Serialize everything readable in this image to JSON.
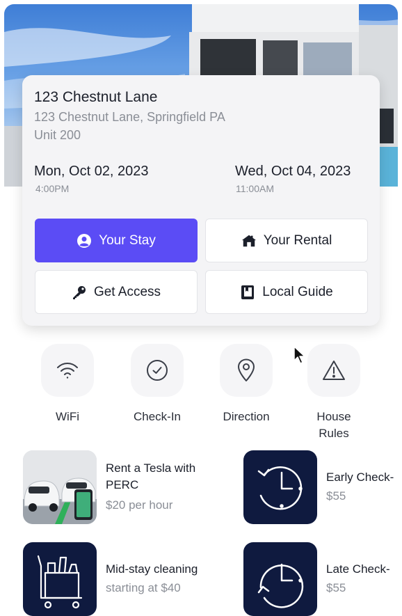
{
  "property": {
    "name": "123 Chestnut Lane",
    "address": "123 Chestnut Lane, Springfield PA",
    "unit": "Unit 200"
  },
  "stay": {
    "check_in_date": "Mon, Oct 02, 2023",
    "check_in_time": "4:00PM",
    "check_out_date": "Wed, Oct 04, 2023",
    "check_out_time": "11:00AM"
  },
  "actions": {
    "your_stay": "Your Stay",
    "your_rental": "Your Rental",
    "get_access": "Get Access",
    "local_guide": "Local Guide"
  },
  "quick_links": {
    "wifi": "WiFi",
    "check_in": "Check-In",
    "direction": "Direction",
    "house_rules": "House Rules"
  },
  "upsells": [
    {
      "title": "Rent a Tesla with",
      "title2": "PERC",
      "price": "$20 per hour"
    },
    {
      "title": "Early Check-",
      "price": "$55"
    },
    {
      "title": "Mid-stay cleaning",
      "price": "starting at $40"
    },
    {
      "title": "Late Check-",
      "price": "$55"
    }
  ],
  "colors": {
    "accent": "#5b4cf5",
    "navy": "#0f1a3f",
    "muted_text": "#8a8e96"
  }
}
